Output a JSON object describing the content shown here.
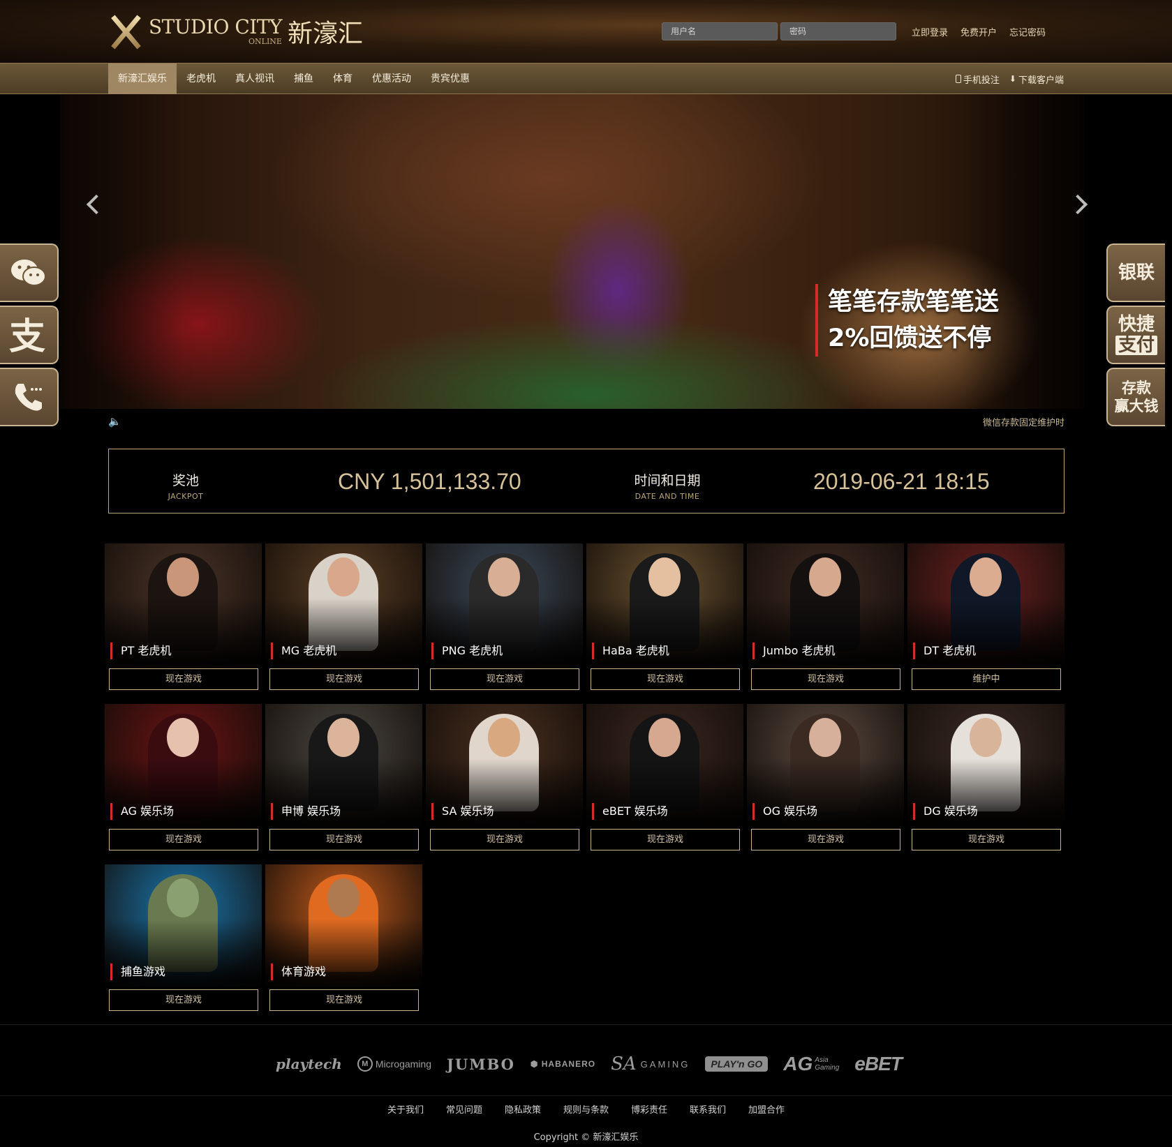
{
  "header": {
    "logo_en": "STUDIO CITY",
    "logo_sub": "ONLINE",
    "logo_cn": "新濠汇",
    "username_placeholder": "用户名",
    "password_placeholder": "密码",
    "login_label": "立即登录",
    "register_label": "免费开户",
    "forgot_label": "忘记密码"
  },
  "nav": {
    "items": [
      {
        "label": "新濠汇娱乐",
        "active": true
      },
      {
        "label": "老虎机"
      },
      {
        "label": "真人视讯"
      },
      {
        "label": "捕鱼"
      },
      {
        "label": "体育"
      },
      {
        "label": "优惠活动"
      },
      {
        "label": "贵宾优惠"
      }
    ],
    "mobile_label": "手机投注",
    "download_label": "下载客户端"
  },
  "banner": {
    "slogan_line1": "笔笔存款笔笔送",
    "slogan_line2": "2%回馈送不停"
  },
  "side_left": [
    "wechat-icon",
    "alipay-icon",
    "phone-icon"
  ],
  "side_right": {
    "unionpay": "银联",
    "quick_line1": "快捷",
    "quick_line2": "支付",
    "deposit_line1": "存款",
    "deposit_line2": "赢大钱"
  },
  "notice": {
    "text": "微信存款固定维护时"
  },
  "jackpot": {
    "label_cn": "奖池",
    "label_en": "JACKPOT",
    "value": "CNY 1,501,133.70",
    "time_label_cn": "时间和日期",
    "time_label_en": "DATE AND TIME",
    "time_value": "2019-06-21 18:15"
  },
  "games": [
    {
      "title": "PT 老虎机",
      "button": "现在游戏",
      "bg": "#4a3428",
      "accent": "#1c1410",
      "skin": "#c9967a"
    },
    {
      "title": "MG 老虎机",
      "button": "现在游戏",
      "bg": "#5a3e24",
      "accent": "#d9d2c8",
      "skin": "#d9a88c"
    },
    {
      "title": "PNG 老虎机",
      "button": "现在游戏",
      "bg": "#3a4a5a",
      "accent": "#2a2a2a",
      "skin": "#d8ae94"
    },
    {
      "title": "HaBa 老虎机",
      "button": "现在游戏",
      "bg": "#6a5230",
      "accent": "#1a1a1a",
      "skin": "#e4c0a0"
    },
    {
      "title": "Jumbo 老虎机",
      "button": "现在游戏",
      "bg": "#3e2a22",
      "accent": "#141010",
      "skin": "#d6a88e"
    },
    {
      "title": "DT 老虎机",
      "button": "维护中",
      "bg": "#6a2020",
      "accent": "#101828",
      "skin": "#dcac90"
    },
    {
      "title": "AG 娱乐场",
      "button": "现在游戏",
      "bg": "#6a1414",
      "accent": "#3a0c10",
      "skin": "#e6c2ae"
    },
    {
      "title": "申博 娱乐场",
      "button": "现在游戏",
      "bg": "#4a4640",
      "accent": "#181818",
      "skin": "#dcb49c"
    },
    {
      "title": "SA 娱乐场",
      "button": "现在游戏",
      "bg": "#4a3020",
      "accent": "#e0d6cc",
      "skin": "#d8a880"
    },
    {
      "title": "eBET 娱乐场",
      "button": "现在游戏",
      "bg": "#3a2620",
      "accent": "#141414",
      "skin": "#d6a890"
    },
    {
      "title": "OG 娱乐场",
      "button": "现在游戏",
      "bg": "#5a4a40",
      "accent": "#3a2a22",
      "skin": "#d6b09a"
    },
    {
      "title": "DG 娱乐场",
      "button": "现在游戏",
      "bg": "#3a2a24",
      "accent": "#e6e0da",
      "skin": "#d8b49a"
    },
    {
      "title": "捕鱼游戏",
      "button": "现在游戏",
      "bg": "#1a78b0",
      "accent": "#6a7a50",
      "skin": "#8aa070"
    },
    {
      "title": "体育游戏",
      "button": "现在游戏",
      "bg": "#c05a1c",
      "accent": "#e06a20",
      "skin": "#b07a50"
    }
  ],
  "providers": {
    "playtech": "playtech",
    "microgaming": "Microgaming",
    "jumbo": "JUMBO",
    "habanero": "HABANERO",
    "sa_mark": "SA",
    "sa_text": "GAMING",
    "playngo": "PLAY'n GO",
    "ag": "AG",
    "ag_sub1": "Asia",
    "ag_sub2": "Gaming",
    "ebet": "eBET"
  },
  "footer": {
    "links": [
      "关于我们",
      "常见问题",
      "隐私政策",
      "规则与条款",
      "博彩责任",
      "联系我们",
      "加盟合作"
    ],
    "copyright": "Copyright © 新濠汇娱乐"
  }
}
